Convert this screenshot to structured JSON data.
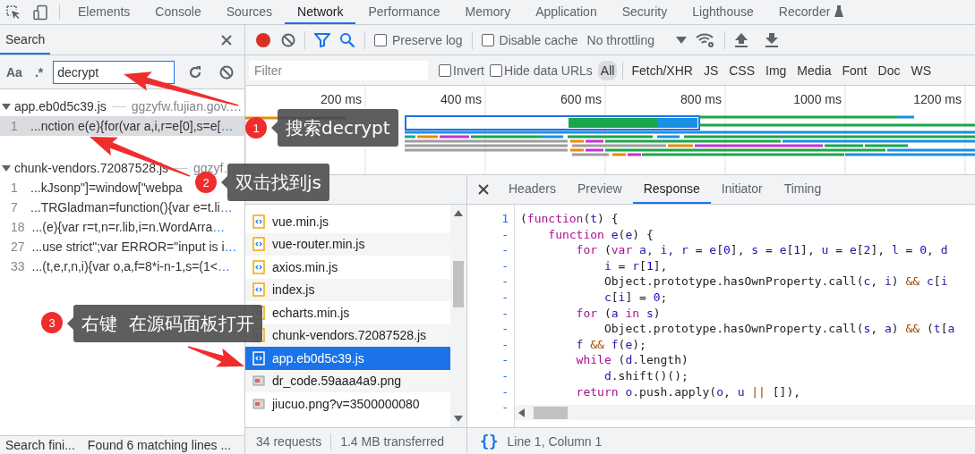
{
  "devtools_tabs": [
    {
      "label": "Elements",
      "selected": false
    },
    {
      "label": "Console",
      "selected": false
    },
    {
      "label": "Sources",
      "selected": false
    },
    {
      "label": "Network",
      "selected": true
    },
    {
      "label": "Performance",
      "selected": false
    },
    {
      "label": "Memory",
      "selected": false
    },
    {
      "label": "Application",
      "selected": false
    },
    {
      "label": "Security",
      "selected": false
    },
    {
      "label": "Lighthouse",
      "selected": false
    },
    {
      "label": "Recorder",
      "selected": false,
      "experimental": true
    }
  ],
  "search_panel": {
    "title": "Search",
    "match_case": "Aa",
    "regex": ".*",
    "query": "decrypt",
    "results": [
      {
        "file": "app.eb0d5c39.js",
        "host": "ggzyfw.fujian.gov.…",
        "expanded": true,
        "matches": [
          {
            "line": "1",
            "text": "...nction e(e){for(var a,i,r=e[0],s=e[",
            "more": "…",
            "selected": true
          }
        ]
      },
      {
        "file": "chunk-vendors.72087528.js",
        "host": "ggzyf…",
        "expanded": true,
        "matches": [
          {
            "line": "1",
            "text": "...kJsonp\"]=window[\"webpa",
            "selected": false
          },
          {
            "line": "7",
            "text": "...TRGladman=function(){var e=t.li",
            "more": "…",
            "selected": false
          },
          {
            "line": "18",
            "text": "...(e){var r=t,n=r.lib,i=n.WordArra",
            "more": "…",
            "selected": false
          },
          {
            "line": "27",
            "text": "...use strict\";var ERROR=\"input is i",
            "more": "…",
            "selected": false
          },
          {
            "line": "33",
            "text": "...(t,e,r,n,i){var o,a,f=8*i-n-1,s=(1<",
            "more": "…",
            "selected": false
          }
        ]
      }
    ],
    "status": "Search fini...",
    "summary": "Found 6 matching lines ..."
  },
  "network_toolbar": {
    "recording": true,
    "preserve_log": {
      "label": "Preserve log",
      "checked": false
    },
    "disable_cache": {
      "label": "Disable cache",
      "checked": false
    },
    "throttling": "No throttling"
  },
  "filter_bar": {
    "placeholder": "Filter",
    "invert": {
      "label": "Invert",
      "checked": false
    },
    "hide_data_urls": {
      "label": "Hide data URLs",
      "checked": false
    },
    "types": [
      {
        "label": "All",
        "selected": true
      },
      {
        "label": "Fetch/XHR",
        "selected": false
      },
      {
        "label": "JS",
        "selected": false
      },
      {
        "label": "CSS",
        "selected": false
      },
      {
        "label": "Img",
        "selected": false
      },
      {
        "label": "Media",
        "selected": false
      },
      {
        "label": "Font",
        "selected": false
      },
      {
        "label": "Doc",
        "selected": false
      },
      {
        "label": "WS",
        "selected": false
      }
    ]
  },
  "overview": {
    "ticks": [
      "200 ms",
      "400 ms",
      "600 ms",
      "800 ms",
      "1000 ms",
      "1200 ms"
    ]
  },
  "requests": {
    "rows": [
      {
        "name": "vue.min.js",
        "kind": "script",
        "selected": false
      },
      {
        "name": "vue-router.min.js",
        "kind": "script",
        "selected": false
      },
      {
        "name": "axios.min.js",
        "kind": "script",
        "selected": false
      },
      {
        "name": "index.js",
        "kind": "script",
        "selected": false
      },
      {
        "name": "echarts.min.js",
        "kind": "script",
        "selected": false
      },
      {
        "name": "chunk-vendors.72087528.js",
        "kind": "script",
        "selected": false
      },
      {
        "name": "app.eb0d5c39.js",
        "kind": "script",
        "selected": true
      },
      {
        "name": "dr_code.59aaa4a9.png",
        "kind": "image",
        "selected": false
      },
      {
        "name": "jiucuo.png?v=3500000080",
        "kind": "image",
        "selected": false
      }
    ],
    "count": "34 requests",
    "transferred": "1.4 MB transferred"
  },
  "response_panel": {
    "tabs": [
      {
        "label": "Headers",
        "selected": false
      },
      {
        "label": "Preview",
        "selected": false
      },
      {
        "label": "Response",
        "selected": true
      },
      {
        "label": "Initiator",
        "selected": false
      },
      {
        "label": "Timing",
        "selected": false
      }
    ],
    "gutter": [
      "1",
      "-",
      "-",
      "-",
      "-",
      "-",
      "-",
      "-",
      "-",
      "-",
      "-",
      "-",
      "-"
    ],
    "code": [
      [
        {
          "text": "(",
          "kind": "plain"
        },
        {
          "text": "function",
          "kind": "keyword"
        },
        {
          "text": "(",
          "kind": "plain"
        },
        {
          "text": "t",
          "kind": "name"
        },
        {
          "text": ") {",
          "kind": "plain"
        }
      ],
      [
        {
          "text": "    function ",
          "kind": "keyword"
        },
        {
          "text": "e",
          "kind": "name"
        },
        {
          "text": "(",
          "kind": "plain"
        },
        {
          "text": "e",
          "kind": "name"
        },
        {
          "text": ") {",
          "kind": "plain"
        }
      ],
      [
        {
          "text": "        for",
          "kind": "keyword"
        },
        {
          "text": " (",
          "kind": "plain"
        },
        {
          "text": "var",
          "kind": "keyword"
        },
        {
          "text": " a, i, r ",
          "kind": "name"
        },
        {
          "text": "= ",
          "kind": "plain"
        },
        {
          "text": "e",
          "kind": "name"
        },
        {
          "text": "[",
          "kind": "plain"
        },
        {
          "text": "0",
          "kind": "number"
        },
        {
          "text": "], ",
          "kind": "plain"
        },
        {
          "text": "s ",
          "kind": "name"
        },
        {
          "text": "= ",
          "kind": "plain"
        },
        {
          "text": "e",
          "kind": "name"
        },
        {
          "text": "[",
          "kind": "plain"
        },
        {
          "text": "1",
          "kind": "number"
        },
        {
          "text": "], ",
          "kind": "plain"
        },
        {
          "text": "u ",
          "kind": "name"
        },
        {
          "text": "= ",
          "kind": "plain"
        },
        {
          "text": "e",
          "kind": "name"
        },
        {
          "text": "[",
          "kind": "plain"
        },
        {
          "text": "2",
          "kind": "number"
        },
        {
          "text": "], ",
          "kind": "plain"
        },
        {
          "text": "l ",
          "kind": "name"
        },
        {
          "text": "= ",
          "kind": "plain"
        },
        {
          "text": "0",
          "kind": "number"
        },
        {
          "text": ", ",
          "kind": "plain"
        },
        {
          "text": "d",
          "kind": "name"
        }
      ],
      [
        {
          "text": "            i ",
          "kind": "name"
        },
        {
          "text": "= ",
          "kind": "plain"
        },
        {
          "text": "r",
          "kind": "name"
        },
        {
          "text": "[",
          "kind": "plain"
        },
        {
          "text": "1",
          "kind": "number"
        },
        {
          "text": "],",
          "kind": "plain"
        }
      ],
      [
        {
          "text": "            Object.prototype.hasOwnProperty.call(",
          "kind": "plain"
        },
        {
          "text": "c",
          "kind": "name"
        },
        {
          "text": ", ",
          "kind": "plain"
        },
        {
          "text": "i",
          "kind": "name"
        },
        {
          "text": ") ",
          "kind": "plain"
        },
        {
          "text": "&& ",
          "kind": "operator"
        },
        {
          "text": "c",
          "kind": "name"
        },
        {
          "text": "[",
          "kind": "plain"
        },
        {
          "text": "i",
          "kind": "name"
        }
      ],
      [
        {
          "text": "            c",
          "kind": "name"
        },
        {
          "text": "[",
          "kind": "plain"
        },
        {
          "text": "i",
          "kind": "name"
        },
        {
          "text": "] = ",
          "kind": "plain"
        },
        {
          "text": "0",
          "kind": "number"
        },
        {
          "text": ";",
          "kind": "plain"
        }
      ],
      [
        {
          "text": "        for",
          "kind": "keyword"
        },
        {
          "text": " (",
          "kind": "plain"
        },
        {
          "text": "a ",
          "kind": "name"
        },
        {
          "text": "in ",
          "kind": "keyword"
        },
        {
          "text": "s",
          "kind": "name"
        },
        {
          "text": ")",
          "kind": "plain"
        }
      ],
      [
        {
          "text": "            Object.prototype.hasOwnProperty.call(",
          "kind": "plain"
        },
        {
          "text": "s",
          "kind": "name"
        },
        {
          "text": ", ",
          "kind": "plain"
        },
        {
          "text": "a",
          "kind": "name"
        },
        {
          "text": ") ",
          "kind": "plain"
        },
        {
          "text": "&&",
          "kind": "operator"
        },
        {
          "text": " (",
          "kind": "plain"
        },
        {
          "text": "t",
          "kind": "name"
        },
        {
          "text": "[",
          "kind": "plain"
        },
        {
          "text": "a",
          "kind": "name"
        }
      ],
      [
        {
          "text": "        f ",
          "kind": "name"
        },
        {
          "text": "&& ",
          "kind": "operator"
        },
        {
          "text": "f",
          "kind": "name"
        },
        {
          "text": "(",
          "kind": "plain"
        },
        {
          "text": "e",
          "kind": "name"
        },
        {
          "text": ");",
          "kind": "plain"
        }
      ],
      [
        {
          "text": "        while",
          "kind": "keyword"
        },
        {
          "text": " (",
          "kind": "plain"
        },
        {
          "text": "d",
          "kind": "name"
        },
        {
          "text": ".length)",
          "kind": "plain"
        }
      ],
      [
        {
          "text": "            d",
          "kind": "name"
        },
        {
          "text": ".shift()();",
          "kind": "plain"
        }
      ],
      [
        {
          "text": "        return ",
          "kind": "keyword"
        },
        {
          "text": "o",
          "kind": "name"
        },
        {
          "text": ".push.apply(",
          "kind": "plain"
        },
        {
          "text": "o",
          "kind": "name"
        },
        {
          "text": ", ",
          "kind": "plain"
        },
        {
          "text": "u ",
          "kind": "name"
        },
        {
          "text": "||",
          "kind": "operator"
        },
        {
          "text": " []),",
          "kind": "plain"
        }
      ]
    ],
    "format_button": "{}",
    "position": "Line 1, Column 1"
  },
  "annotations": [
    {
      "number": "1",
      "text": "搜索decrypt"
    },
    {
      "number": "2",
      "text": "双击找到js"
    },
    {
      "number": "3",
      "text": "右键  在源码面板打开"
    }
  ]
}
